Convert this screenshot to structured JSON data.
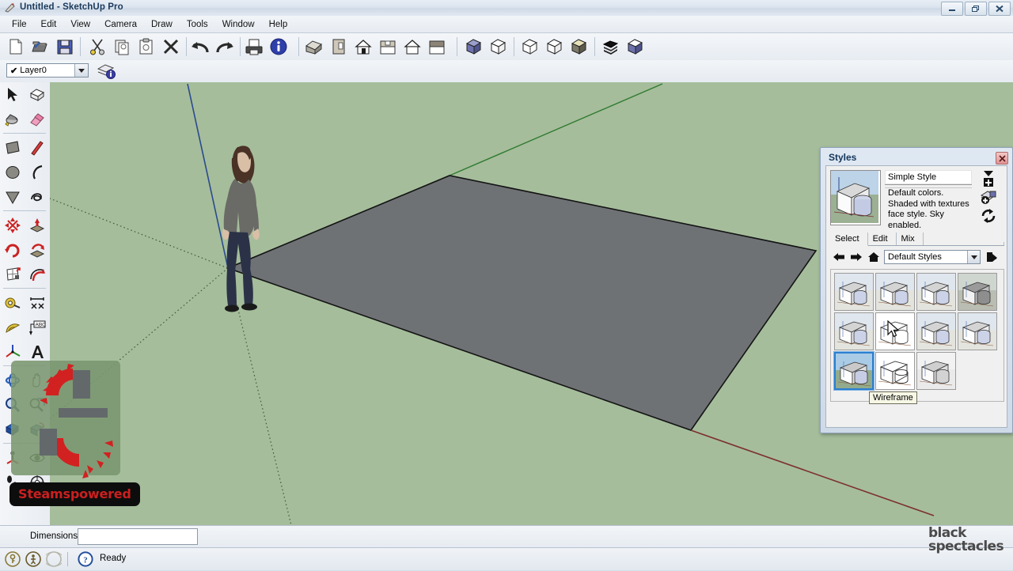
{
  "window": {
    "title": "Untitled - SketchUp Pro",
    "app_icon": "pencil-icon",
    "controls": [
      {
        "name": "minimize",
        "glyph": "minimize-icon"
      },
      {
        "name": "restore",
        "glyph": "restore-icon"
      },
      {
        "name": "close",
        "glyph": "close-icon"
      }
    ]
  },
  "menubar": {
    "items": [
      "File",
      "Edit",
      "View",
      "Camera",
      "Draw",
      "Tools",
      "Window",
      "Help"
    ]
  },
  "toolbar": {
    "groups": [
      {
        "name": "file",
        "buttons": [
          {
            "name": "new-document-button",
            "icon": "new-document-icon"
          },
          {
            "name": "open-document-button",
            "icon": "open-folder-icon"
          },
          {
            "name": "save-button",
            "icon": "floppy-disk-icon"
          }
        ]
      },
      {
        "name": "edit",
        "buttons": [
          {
            "name": "cut-button",
            "icon": "scissors-icon"
          },
          {
            "name": "copy-button",
            "icon": "copy-icon"
          },
          {
            "name": "paste-button",
            "icon": "clipboard-icon"
          },
          {
            "name": "erase-button",
            "icon": "x-delete-icon"
          }
        ]
      },
      {
        "name": "history",
        "buttons": [
          {
            "name": "undo-button",
            "icon": "undo-arrow-icon"
          },
          {
            "name": "redo-button",
            "icon": "redo-arrow-icon"
          }
        ]
      },
      {
        "name": "output",
        "buttons": [
          {
            "name": "print-button",
            "icon": "printer-icon"
          },
          {
            "name": "model-info-button",
            "icon": "info-circle-icon"
          }
        ]
      },
      {
        "name": "views",
        "buttons": [
          {
            "name": "iso-view-button",
            "icon": "house-iso-icon"
          },
          {
            "name": "top-view-button",
            "icon": "house-top-icon"
          },
          {
            "name": "front-view-button",
            "icon": "house-front-icon"
          },
          {
            "name": "right-view-button",
            "icon": "house-right-icon"
          },
          {
            "name": "back-view-button",
            "icon": "house-back-icon"
          },
          {
            "name": "left-view-button",
            "icon": "house-left-icon"
          }
        ]
      },
      {
        "name": "styles",
        "buttons": [
          {
            "name": "xray-style-button",
            "icon": "cube-xray-icon"
          },
          {
            "name": "wireframe-style-button",
            "icon": "cube-wireframe-icon"
          },
          {
            "name": "hidden-line-style-button",
            "icon": "cube-hiddenline-icon"
          },
          {
            "name": "shaded-style-button",
            "icon": "cube-shaded-icon"
          },
          {
            "name": "texture-style-button",
            "icon": "cube-texture-icon"
          },
          {
            "name": "monochrome-style-button",
            "icon": "cube-mono-icon"
          },
          {
            "name": "section-style-button",
            "icon": "cube-section-icon"
          }
        ]
      }
    ]
  },
  "layerbar": {
    "current_layer": "Layer0",
    "checked": "✔",
    "layer_manager_icon": "layers-info-icon"
  },
  "lefttoolbar": {
    "rows": [
      [
        {
          "name": "select-tool",
          "icon": "arrow-cursor-icon"
        },
        {
          "name": "make-component-tool",
          "icon": "component-box-icon"
        }
      ],
      [
        {
          "name": "paint-bucket-tool",
          "icon": "paint-bucket-icon"
        },
        {
          "name": "eraser-tool",
          "icon": "eraser-icon"
        }
      ],
      [
        {
          "name": "rectangle-tool",
          "icon": "rectangle-icon"
        },
        {
          "name": "line-tool",
          "icon": "pencil-line-icon"
        }
      ],
      [
        {
          "name": "circle-tool",
          "icon": "circle-icon"
        },
        {
          "name": "arc-tool",
          "icon": "arc-icon"
        }
      ],
      [
        {
          "name": "polygon-tool",
          "icon": "polygon-icon"
        },
        {
          "name": "freehand-tool",
          "icon": "freehand-icon"
        }
      ],
      [
        {
          "name": "move-tool",
          "icon": "move-cross-icon"
        },
        {
          "name": "pushpull-tool",
          "icon": "pushpull-icon"
        }
      ],
      [
        {
          "name": "rotate-tool",
          "icon": "rotate-icon"
        },
        {
          "name": "followme-tool",
          "icon": "followme-icon"
        }
      ],
      [
        {
          "name": "scale-tool",
          "icon": "scale-icon"
        },
        {
          "name": "offset-tool",
          "icon": "offset-icon"
        }
      ],
      [
        {
          "name": "tape-measure-tool",
          "icon": "tape-measure-icon"
        },
        {
          "name": "dimension-tool",
          "icon": "dimension-icon"
        }
      ],
      [
        {
          "name": "protractor-tool",
          "icon": "protractor-icon"
        },
        {
          "name": "text-tool",
          "icon": "abc-text-icon"
        }
      ],
      [
        {
          "name": "axes-tool",
          "icon": "axes-icon"
        },
        {
          "name": "3d-text-tool",
          "icon": "3d-text-icon"
        }
      ],
      [
        {
          "name": "orbit-tool",
          "icon": "orbit-icon"
        },
        {
          "name": "pan-tool",
          "icon": "hand-pan-icon"
        }
      ],
      [
        {
          "name": "zoom-tool",
          "icon": "magnifier-icon"
        },
        {
          "name": "zoom-window-tool",
          "icon": "zoom-window-icon"
        }
      ],
      [
        {
          "name": "zoom-extents-tool",
          "icon": "zoom-extents-icon"
        },
        {
          "name": "previous-view-tool",
          "icon": "previous-view-icon"
        }
      ],
      [
        {
          "name": "position-camera-tool",
          "icon": "position-camera-icon"
        },
        {
          "name": "look-around-tool",
          "icon": "eye-icon"
        }
      ],
      [
        {
          "name": "walk-tool",
          "icon": "footsteps-icon"
        },
        {
          "name": "section-plane-tool",
          "icon": "section-plane-icon"
        }
      ]
    ]
  },
  "viewport": {
    "background_sky": "#a5bd9b",
    "ground_face_color": "#6f7275",
    "axis_blue": "#1e3f8f",
    "axis_green": "#1f6b1f",
    "axis_red": "#8a2b2b",
    "figure_name": "scale-figure-person"
  },
  "styles_panel": {
    "title": "Styles",
    "close_glyph": "×",
    "preview_name": "style-preview-thumbnail",
    "style_name": "Simple Style",
    "style_description": "Default colors.  Shaded with textures face style.  Sky enabled.",
    "actions": [
      {
        "name": "create-new-style-button",
        "icon": "new-style-icon"
      },
      {
        "name": "update-style-button",
        "icon": "update-style-icon"
      },
      {
        "name": "refresh-button",
        "icon": "refresh-icon"
      }
    ],
    "tabs": [
      {
        "label": "Select",
        "active": true
      },
      {
        "label": "Edit",
        "active": false
      },
      {
        "label": "Mix",
        "active": false
      }
    ],
    "nav": {
      "back_icon": "back-arrow-icon",
      "forward_icon": "forward-arrow-icon",
      "home_icon": "home-icon",
      "details_icon": "details-flyout-icon",
      "collection": "Default Styles"
    },
    "grid": {
      "rows": [
        [
          {
            "name": "style-thumb-1",
            "selected": false,
            "variant": "shaded"
          },
          {
            "name": "style-thumb-2",
            "selected": false,
            "variant": "shaded"
          },
          {
            "name": "style-thumb-3",
            "selected": false,
            "variant": "shaded"
          },
          {
            "name": "style-thumb-4",
            "selected": false,
            "variant": "shaded-dark"
          }
        ],
        [
          {
            "name": "style-thumb-5",
            "selected": false,
            "variant": "shaded"
          },
          {
            "name": "style-thumb-6",
            "selected": false,
            "variant": "hiddenline"
          },
          {
            "name": "style-thumb-7",
            "selected": false,
            "variant": "shaded"
          },
          {
            "name": "style-thumb-8",
            "selected": false,
            "variant": "shaded"
          }
        ],
        [
          {
            "name": "style-thumb-9",
            "selected": true,
            "variant": "shaded-sky"
          },
          {
            "name": "style-thumb-10",
            "selected": false,
            "variant": "wireframe"
          },
          {
            "name": "style-thumb-11",
            "selected": false,
            "variant": "mono"
          }
        ]
      ]
    },
    "tooltip": "Wireframe"
  },
  "dimensions_bar": {
    "label": "Dimensions",
    "value": "",
    "placeholder": ""
  },
  "statusbar": {
    "icons": [
      {
        "name": "key-hint-icon"
      },
      {
        "name": "person-hint-icon"
      },
      {
        "name": "globe-hint-icon"
      }
    ],
    "help_icon": "question-circle-icon",
    "message": "Ready"
  },
  "watermark": {
    "line1": "black",
    "line2": "spectacles"
  },
  "overlay": {
    "brand": "Steamspowered",
    "gear_color": "#d22121"
  }
}
